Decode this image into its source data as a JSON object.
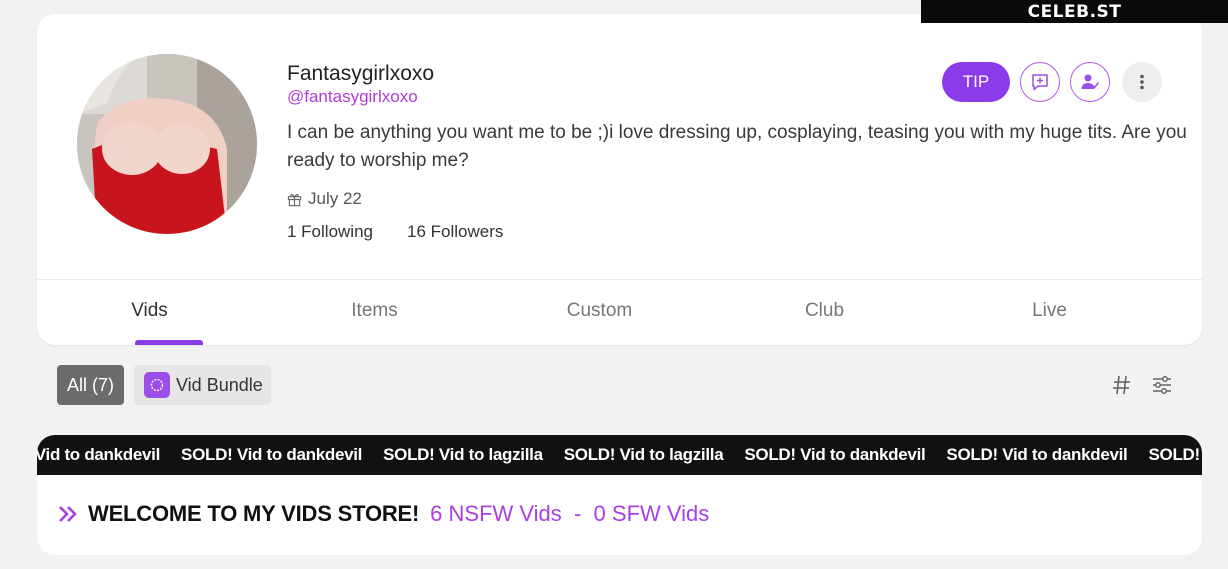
{
  "watermark": "CELEB.ST",
  "profile": {
    "name": "Fantasygirlxoxo",
    "handle": "@fantasygirlxoxo",
    "bio": "I can be anything you want me to be ;)i love dressing up, cosplaying, teasing you with my huge tits. Are you ready to worship me?",
    "birthday": "July 22",
    "following": "1 Following",
    "followers": "16 Followers"
  },
  "actions": {
    "tip_label": "TIP",
    "icons": [
      "message-plus-icon",
      "user-check-icon",
      "more-vertical-icon"
    ]
  },
  "tabs": [
    {
      "label": "Vids",
      "active": true
    },
    {
      "label": "Items",
      "active": false
    },
    {
      "label": "Custom",
      "active": false
    },
    {
      "label": "Club",
      "active": false
    },
    {
      "label": "Live",
      "active": false
    }
  ],
  "filters": {
    "all_label": "All (7)",
    "bundle_label": "Vid Bundle"
  },
  "ticker": [
    "! Vid to dankdevil",
    "SOLD! Vid to dankdevil",
    "SOLD! Vid to lagzilla",
    "SOLD! Vid to lagzilla",
    "SOLD! Vid to dankdevil",
    "SOLD! Vid to dankdevil",
    "SOLD!"
  ],
  "store": {
    "title": "WELCOME TO MY VIDS STORE!",
    "counts": "6 NSFW Vids  -  0 SFW Vids"
  },
  "colors": {
    "accent": "#8a3ce8",
    "handle": "#b23ad8",
    "counts": "#a83fe0"
  }
}
